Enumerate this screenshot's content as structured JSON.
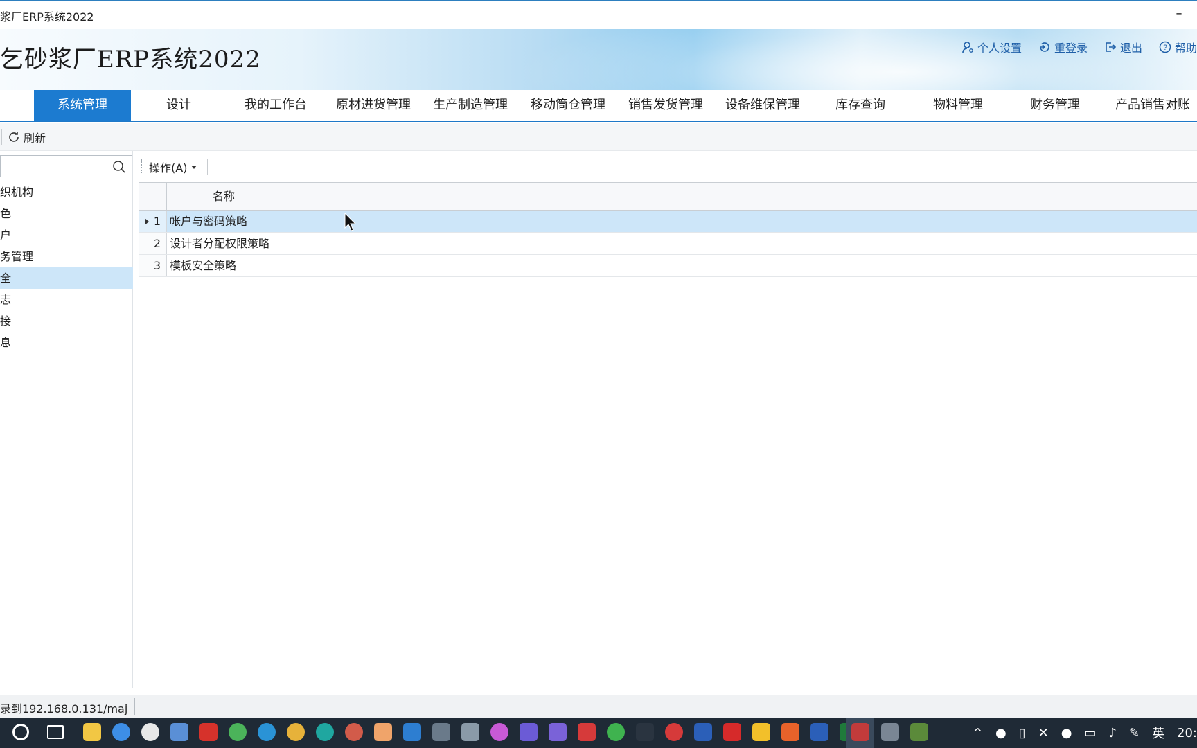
{
  "window": {
    "title": "浆厂ERP系统2022",
    "minimize_glyph": "–"
  },
  "banner": {
    "app_title": "乞砂浆厂ERP系统2022"
  },
  "top_links": [
    {
      "label": "个人设置",
      "icon": "user-icon"
    },
    {
      "label": "重登录",
      "icon": "relogin-icon"
    },
    {
      "label": "退出",
      "icon": "exit-icon"
    },
    {
      "label": "帮助",
      "icon": "help-icon"
    }
  ],
  "nav": {
    "items": [
      "系统管理",
      "设计",
      "我的工作台",
      "原材进货管理",
      "生产制造管理",
      "移动筒仓管理",
      "销售发货管理",
      "设备维保管理",
      "库存查询",
      "物料管理",
      "财务管理",
      "产品销售对账"
    ],
    "active_index": 0
  },
  "toolbar": {
    "refresh_label": "刷新"
  },
  "left_panel": {
    "search_placeholder": "",
    "tree_items": [
      "织机构",
      "色",
      "户",
      "务管理",
      "全",
      "志",
      "接",
      "息"
    ],
    "selected_index": 4
  },
  "operations": {
    "label": "操作(A)"
  },
  "grid": {
    "columns": [
      "名称"
    ],
    "rows": [
      {
        "num": "1",
        "name": "帐户与密码策略"
      },
      {
        "num": "2",
        "name": "设计者分配权限策略"
      },
      {
        "num": "3",
        "name": "模板安全策略"
      }
    ],
    "selected_row": 0
  },
  "status": {
    "text": "录到192.168.0.131/maj"
  },
  "taskbar": {
    "ime": "英",
    "clock": "20:"
  },
  "colors": {
    "accent": "#1c7bd0",
    "selection": "#cde6f9",
    "link": "#1f5fa8",
    "taskbar": "#1f2a36"
  }
}
